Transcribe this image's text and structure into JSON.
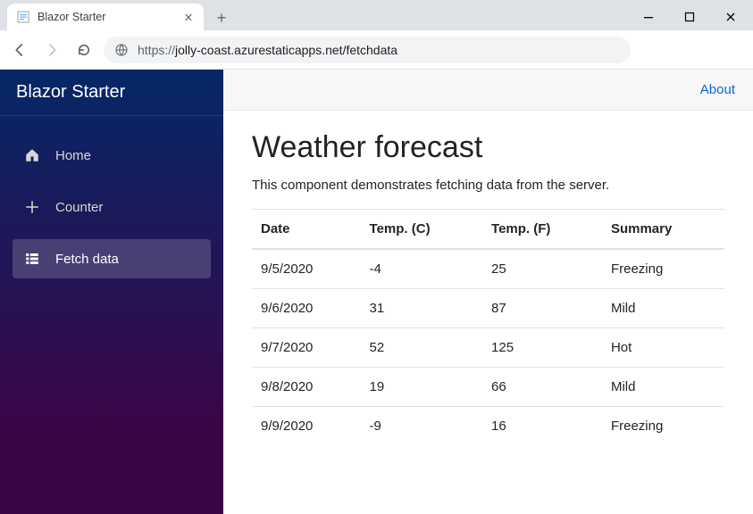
{
  "browser": {
    "tab_title": "Blazor Starter",
    "url_scheme": "https://",
    "url_rest": "jolly-coast.azurestaticapps.net/fetchdata"
  },
  "sidebar": {
    "brand": "Blazor Starter",
    "items": [
      {
        "label": "Home",
        "icon": "home-icon",
        "active": false
      },
      {
        "label": "Counter",
        "icon": "plus-icon",
        "active": false
      },
      {
        "label": "Fetch data",
        "icon": "list-icon",
        "active": true
      }
    ]
  },
  "topbar": {
    "about_label": "About"
  },
  "page": {
    "title": "Weather forecast",
    "subtitle": "This component demonstrates fetching data from the server."
  },
  "table": {
    "headers": [
      "Date",
      "Temp. (C)",
      "Temp. (F)",
      "Summary"
    ],
    "rows": [
      {
        "date": "9/5/2020",
        "tempC": "-4",
        "tempF": "25",
        "summary": "Freezing"
      },
      {
        "date": "9/6/2020",
        "tempC": "31",
        "tempF": "87",
        "summary": "Mild"
      },
      {
        "date": "9/7/2020",
        "tempC": "52",
        "tempF": "125",
        "summary": "Hot"
      },
      {
        "date": "9/8/2020",
        "tempC": "19",
        "tempF": "66",
        "summary": "Mild"
      },
      {
        "date": "9/9/2020",
        "tempC": "-9",
        "tempF": "16",
        "summary": "Freezing"
      }
    ]
  }
}
